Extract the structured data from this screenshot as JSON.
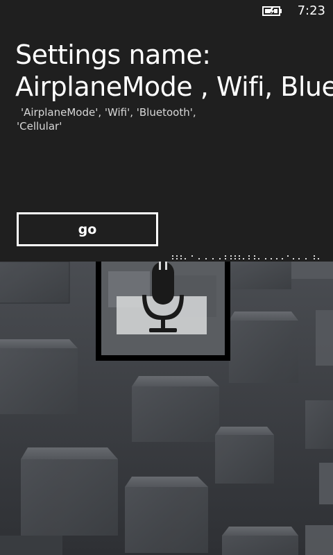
{
  "status_bar": {
    "time": "7:23",
    "battery_icon": "battery-charging-icon"
  },
  "main": {
    "title_line1": "Settings name:",
    "title_line2": "AirplaneMode , Wifi, Blue",
    "options_line1": "'AirplaneMode', 'Wifi', 'Bluetooth',",
    "options_line2": "'Cellular'",
    "go_label": "go"
  },
  "voice": {
    "icon": "microphone-icon"
  },
  "colors": {
    "panel_background": "#1f1f1f",
    "text": "#ffffff",
    "secondary_text": "#d8d8d8",
    "backdrop": "#3a3d41"
  }
}
